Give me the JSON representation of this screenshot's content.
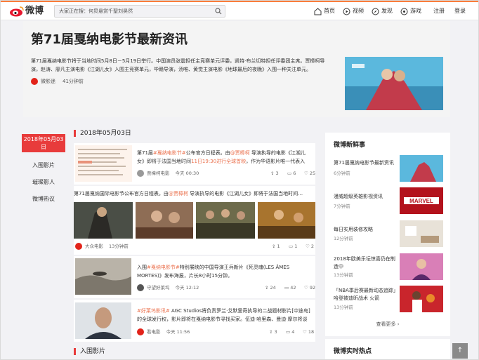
{
  "brand": {
    "name": "微博",
    "color": "#e6162d",
    "accent": "#fa7d3c"
  },
  "search": {
    "placeholder": "大家正在搜：何炅悬赏千聖刘昊然"
  },
  "nav": {
    "home": "首页",
    "video": "视频",
    "discover": "发现",
    "game": "游戏",
    "register": "注册",
    "login": "登录"
  },
  "hero": {
    "title": "第71届戛纳电影节最新资讯",
    "desc": "第71届戛纳电影节将于当地时间5月8日－5月19日举行。中国演员张震担任主竞赛单元评委，凯特·布兰切特担任评委团主席。贾樟柯导演，赵涛、廖凡主演电影《江湖儿女》入围主竞赛单元，毕赣导演，汤唯、黄觉主演电影《地球最后的夜晚》入围一种关注单元。",
    "source": "微影迷",
    "time": "41分钟前"
  },
  "left_nav": {
    "date_tab": "2018年05月03日",
    "items": [
      "入围影片",
      "璀璨影人",
      "微博热议"
    ]
  },
  "section1": {
    "date": "2018年05月03日"
  },
  "post1": {
    "prefix": "第71届",
    "tag": "#戛纳电影节#",
    "text1": "公布官方日程表。由",
    "mention": "@贾樟柯",
    "text2": " 导演执导的电影《江湖儿女》即将于法国当地时间",
    "link": "11日19:30进行全球首映",
    "text3": "，作为华语影片唯一代表入",
    "author": "贾樟柯电影",
    "time": "今天 00:30",
    "reposts": "3",
    "comments": "6",
    "likes": "25"
  },
  "post2": {
    "text1": "第71届戛纳国际电影节公布官方日程表。由",
    "mention": "@贾樟柯",
    "text2": " 导演执导的电影《江湖儿女》即将于法国当地时间…",
    "author": "大众电影",
    "time": "13分钟前",
    "reposts": "1",
    "comments": "1",
    "likes": "2"
  },
  "post3": {
    "prefix": "入围",
    "tag": "#戛纳电影节#",
    "text1": "特别展映的中国导演王兵新片《死灵魂(LES ÂMES MORTES)》发布海报，片长8小时15分钟。",
    "author": "守望好莱坞",
    "time": "今天 12:12",
    "reposts": "24",
    "comments": "42",
    "likes": "92"
  },
  "post4": {
    "tag": "#好莱坞影讯#",
    "text1": " AGC Studios将负责罗兰·艾默里奇执导的二战题材影片[中途岛]的全球发行权，影片即将在戛纳电影节寻找买家。伍迪·哈里森、曼迪·摩尔将谈",
    "author": "看电影",
    "time": "今天 11:56",
    "reposts": "3",
    "comments": "4",
    "likes": "18"
  },
  "section2": {
    "title": "入围影片"
  },
  "right_panel": {
    "title": "微博新鲜事",
    "items": [
      {
        "title": "第71届戛纳电影节最新资讯",
        "time": "6分钟前"
      },
      {
        "title": "漫威超级英雄影视资讯",
        "time": "7分钟前"
      },
      {
        "title": "每日实用装修攻略",
        "time": "12分钟前"
      },
      {
        "title": "2018年欧美乐坛惊喜仍在制造中",
        "time": "13分钟前"
      },
      {
        "title": "「NBA季后赛最新动态追踪」哈登被迪昕战术 火箭",
        "time": "13分钟前"
      }
    ],
    "more": "查看更多 ›",
    "hot_title": "微博实时热点"
  },
  "to_top": "↑"
}
